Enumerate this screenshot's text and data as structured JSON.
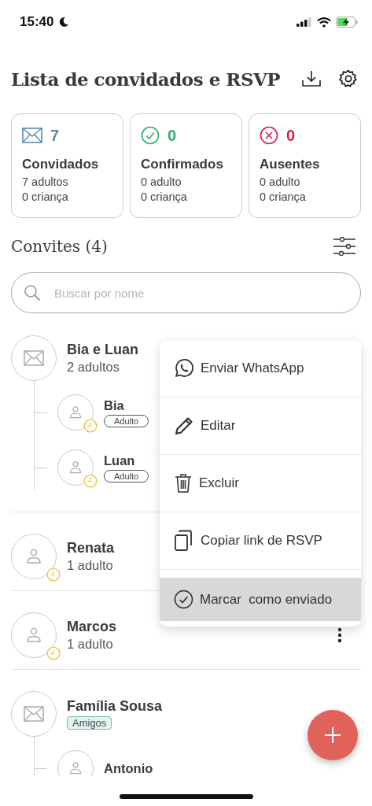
{
  "status_bar": {
    "time": "15:40"
  },
  "title": "Lista de convidados e RSVP",
  "stats": [
    {
      "kind": "invited",
      "count": "7",
      "label": "Convidados",
      "adults": "7 adultos",
      "children": "0 criança"
    },
    {
      "kind": "confirmed",
      "count": "0",
      "label": "Confirmados",
      "adults": "0 adulto",
      "children": "0 criança"
    },
    {
      "kind": "absent",
      "count": "0",
      "label": "Ausentes",
      "adults": "0 adulto",
      "children": "0 criança"
    }
  ],
  "section": {
    "title": "Convites (4)"
  },
  "search": {
    "placeholder": "Buscar por nome"
  },
  "invites": [
    {
      "kind": "group",
      "name": "Bia e Luan",
      "detail": "2 adultos",
      "members": [
        {
          "name": "Bia",
          "tag": "Adulto",
          "pending": true
        },
        {
          "name": "Luan",
          "tag": "Adulto",
          "pending": true
        }
      ]
    },
    {
      "kind": "single",
      "name": "Renata",
      "detail": "1 adulto",
      "pending": true
    },
    {
      "kind": "single",
      "name": "Marcos",
      "detail": "1 adulto",
      "pending": true,
      "more_button": true
    },
    {
      "kind": "group",
      "name": "Família Sousa",
      "tag": "Amigos",
      "members": [
        {
          "name": "Antonio"
        }
      ]
    }
  ],
  "menu": {
    "items": [
      {
        "kind": "whatsapp",
        "label": "Enviar WhatsApp",
        "selected": false
      },
      {
        "kind": "edit",
        "label": "Editar",
        "selected": false
      },
      {
        "kind": "delete",
        "label": "Excluir",
        "selected": false
      },
      {
        "kind": "copy",
        "label": "Copiar link de RSVP",
        "selected": false
      },
      {
        "kind": "mark-sent",
        "label": "Marcar  como enviado",
        "selected": true
      }
    ]
  }
}
